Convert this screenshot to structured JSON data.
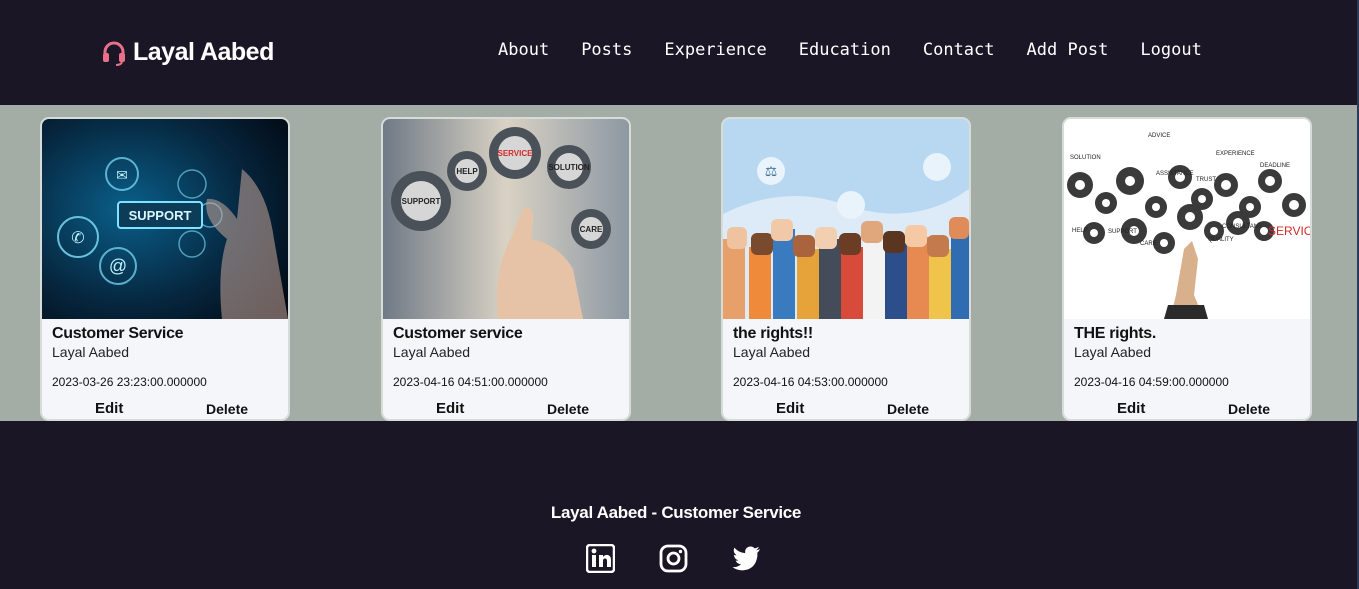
{
  "brand": {
    "name": "Layal Aabed",
    "icon": "headset-icon",
    "icon_color": "#e8708a"
  },
  "nav": [
    "About",
    "Posts",
    "Experience",
    "Education",
    "Contact",
    "Add Post",
    "Logout"
  ],
  "posts": [
    {
      "title": "Customer Service",
      "author": "Layal Aabed",
      "date": "2023-03-26 23:23:00.000000",
      "edit": "Edit",
      "delete": "Delete"
    },
    {
      "title": "Customer service",
      "author": "Layal Aabed",
      "date": "2023-04-16 04:51:00.000000",
      "edit": "Edit",
      "delete": "Delete"
    },
    {
      "title": "the rights!!",
      "author": "Layal Aabed",
      "date": "2023-04-16 04:53:00.000000",
      "edit": "Edit",
      "delete": "Delete"
    },
    {
      "title": "THE rights.",
      "author": "Layal Aabed",
      "date": "2023-04-16 04:59:00.000000",
      "edit": "Edit",
      "delete": "Delete"
    }
  ],
  "image_text": {
    "img1": "SUPPORT",
    "img2": [
      "SUPPORT",
      "HELP",
      "SERVICE",
      "SOLUTION",
      "CARE"
    ],
    "img4": [
      "SOLUTION",
      "ADVICE",
      "EXPERIENCE",
      "ASSISTANCE",
      "TRUST",
      "DEADLINE",
      "HELP",
      "SUPPORT",
      "CARE",
      "QUALITY",
      "CONSULTANT",
      "SERVICE"
    ]
  },
  "footer": {
    "text": "Layal Aabed - Customer Service",
    "socials": [
      "linkedin-icon",
      "instagram-icon",
      "twitter-icon"
    ]
  },
  "colors": {
    "nav_bg": "#1a1626",
    "content_bg": "#a4ada5",
    "card_bg": "#f4f6f9",
    "accent": "#e8708a"
  }
}
